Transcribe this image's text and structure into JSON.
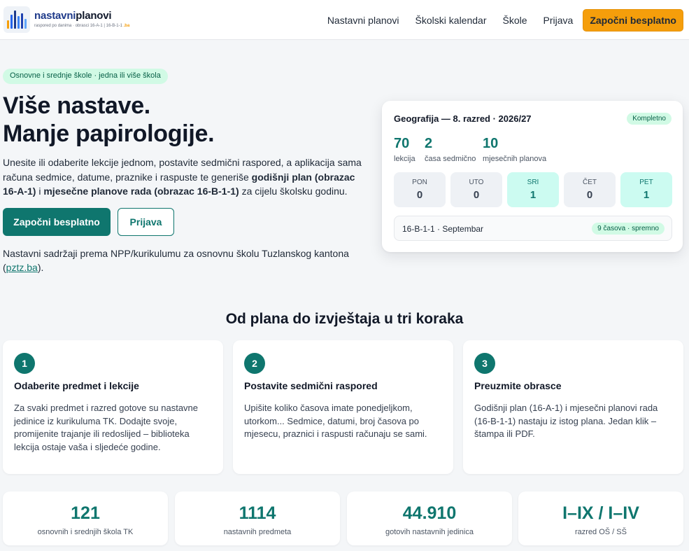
{
  "header": {
    "brand_part1": "nastavni",
    "brand_part2": "planovi",
    "tagline": "raspored po danima · obrasci 16-A-1 | 16-B-1-1",
    "tagline_tld": ".ba",
    "nav": {
      "plans": "Nastavni planovi",
      "calendar": "Školski kalendar",
      "schools": "Škole",
      "login": "Prijava",
      "cta": "Započni besplatno"
    }
  },
  "hero": {
    "pill": "Osnovne i srednje škole · jedna ili više škola",
    "title_line1": "Više nastave.",
    "title_line2": "Manje papirologije.",
    "desc_part1": "Unesite ili odaberite lekcije jednom, postavite sedmični raspored, a aplikacija sama računa sedmice, datume, praznike i raspuste te generiše ",
    "desc_bold1": "godišnji plan (obrazac 16-A-1)",
    "desc_part2": " i ",
    "desc_bold2": "mjesečne planove rada (obrazac 16-B-1-1)",
    "desc_part3": " za cijelu školsku godinu.",
    "primary_button": "Započni besplatno",
    "secondary_button": "Prijava",
    "note_text": "Nastavni sadržaji prema NPP/kurikulumu za osnovnu školu Tuzlanskog kantona (",
    "note_link": "pztz.ba",
    "note_end": ")."
  },
  "preview": {
    "title": "Geografija — 8. razred · 2026/27",
    "badge": "Kompletno",
    "stats": [
      {
        "value": "70",
        "label": "lekcija"
      },
      {
        "value": "2",
        "label": "časa sedmično"
      },
      {
        "value": "10",
        "label": "mjesečnih planova"
      }
    ],
    "days": [
      {
        "name": "PON",
        "value": "0"
      },
      {
        "name": "UTO",
        "value": "0"
      },
      {
        "name": "SRI",
        "value": "1"
      },
      {
        "name": "ČET",
        "value": "0"
      },
      {
        "name": "PET",
        "value": "1"
      }
    ],
    "month_label": "16-B-1-1 · Septembar",
    "month_badge": "9 časova · spremno"
  },
  "steps": {
    "title": "Od plana do izvještaja u tri koraka",
    "items": [
      {
        "num": "1",
        "title": "Odaberite predmet i lekcije",
        "text": "Za svaki predmet i razred gotove su nastavne jedinice iz kurikuluma TK. Dodajte svoje, promijenite trajanje ili redoslijed – biblioteka lekcija ostaje vaša i sljedeće godine."
      },
      {
        "num": "2",
        "title": "Postavite sedmični raspored",
        "text": "Upišite koliko časova imate ponedjeljkom, utorkom... Sedmice, datumi, broj časova po mjesecu, praznici i raspusti računaju se sami."
      },
      {
        "num": "3",
        "title": "Preuzmite obrasce",
        "text": "Godišnji plan (16-A-1) i mjesečni planovi rada (16-B-1-1) nastaju iz istog plana. Jedan klik – štampa ili PDF."
      }
    ]
  },
  "stats": [
    {
      "value": "121",
      "label": "osnovnih i srednjih škola TK"
    },
    {
      "value": "1114",
      "label": "nastavnih predmeta"
    },
    {
      "value": "44.910",
      "label": "gotovih nastavnih jedinica"
    },
    {
      "value": "I–IX / I–IV",
      "label": "razred OŠ / SŠ"
    }
  ],
  "colors": {
    "accent": "#0f766e",
    "cta": "#f59e0b",
    "badge_bg": "#d1fae5"
  }
}
